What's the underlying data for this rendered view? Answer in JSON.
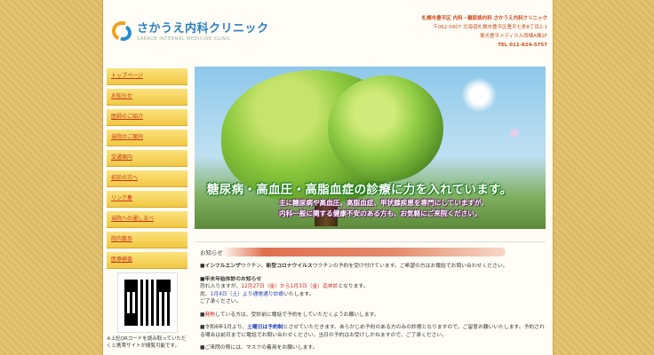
{
  "header": {
    "logo_text": "さかうえ内科クリニック",
    "logo_sub": "SAKAUE INTERNAL MEDICINE CLINIC",
    "info_line1": "札幌市豊平区 内科・糖尿病内科 さかうえ内科クリニック",
    "address1": "〒062-0907 北海道札幌市豊平区豊平七条8丁目2-1",
    "address2": "東光豊平メディカル西棟A棟2F",
    "tel": "TEL 011-824-5757"
  },
  "nav": {
    "items": [
      {
        "label": "トップページ"
      },
      {
        "label": "お知らせ"
      },
      {
        "label": "医師のご紹介"
      },
      {
        "label": "当院のご案内"
      },
      {
        "label": "交通案内"
      },
      {
        "label": "初診の方へ"
      },
      {
        "label": "リンク集"
      },
      {
        "label": "当院への通しるべ"
      },
      {
        "label": "院内散歩"
      },
      {
        "label": "医療検査"
      }
    ]
  },
  "qr": {
    "note": "※上記QRコードを読み取っていただくと携帯サイトが閲覧可能です。"
  },
  "hero": {
    "title": "糖尿病・高血圧・高脂血症の診療に力を入れています。",
    "sub1": "主に糖尿病や高血圧、高脂血症、甲状腺疾患を専門にしていますが、",
    "sub2": "内科一般に関する健康不安のある方も、お気軽にご来院ください。"
  },
  "news": {
    "title": "お知らせ",
    "item1_a": "■インフルエンザ",
    "item1_b": "ワクチン、",
    "item1_c": "新型コロナウイルス",
    "item1_d": "ワクチンの予約を受け付けています。ご希望の方はお電話でお問い合わせください。",
    "item2_head": "■年末年始休診のお知らせ",
    "item2_l1a": "恐れ入りますが、",
    "item2_l1b": "12月27日（金）から1月3日（金）迄休診",
    "item2_l1c": "となります。",
    "item2_l2a": "尚、",
    "item2_l2b": "1月4日（土）より通常通り診療",
    "item2_l2c": "いたします。",
    "item2_l3": "ご了承ください。",
    "item3_a": "■",
    "item3_b": "発熱",
    "item3_c": "している方は、受診前に電話で予約をしていただくようお願いします。",
    "item4_a": "■令和6年1月より、",
    "item4_b": "土曜日は予約制",
    "item4_c": "とさせていただきます。あらかじめ予約のある方のみの診療となりますので、ご留意お願いいたします。予約される場合は前日までに電話でお問い合わせください。当日の予約はお受けしかねますので、ご了承ください。",
    "item5": "■ご来院の際には、マスクの着用をお願いします。"
  }
}
